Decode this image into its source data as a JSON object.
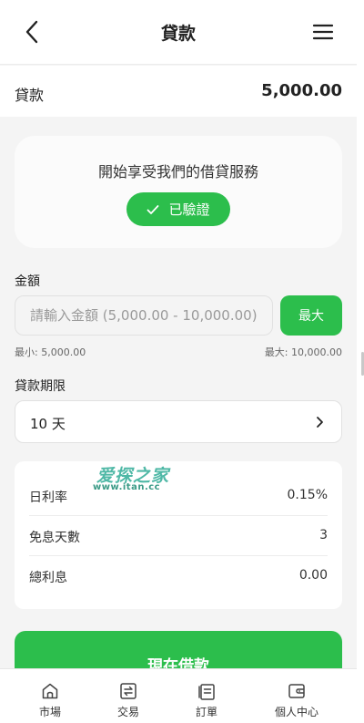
{
  "header": {
    "title": "貸款",
    "back_icon": "chevron-left-icon",
    "menu_icon": "hamburger-menu-icon"
  },
  "summary": {
    "label": "貸款",
    "value": "5,000.00"
  },
  "verify": {
    "text": "開始享受我們的借貸服務",
    "badge_label": "已驗證",
    "badge_icon": "check-icon"
  },
  "amount": {
    "label": "金額",
    "placeholder": "請輸入金額 (5,000.00 - 10,000.00)",
    "value": "",
    "max_button": "最大",
    "min_text": "最小: 5,000.00",
    "max_text": "最大: 10,000.00"
  },
  "period": {
    "label": "貸款期限",
    "value": "10 天",
    "chevron_icon": "chevron-right-icon"
  },
  "info": {
    "rows": [
      {
        "label": "日利率",
        "value": "0.15%"
      },
      {
        "label": "免息天數",
        "value": "3"
      },
      {
        "label": "總利息",
        "value": "0.00"
      }
    ]
  },
  "watermark": {
    "main": "爱探之家",
    "sub": "www.itan.cc"
  },
  "cta": {
    "label": "現在借款"
  },
  "tabbar": {
    "items": [
      {
        "label": "市場",
        "icon": "home-icon"
      },
      {
        "label": "交易",
        "icon": "exchange-icon"
      },
      {
        "label": "訂單",
        "icon": "orders-icon"
      },
      {
        "label": "個人中心",
        "icon": "wallet-icon"
      }
    ]
  },
  "colors": {
    "accent": "#2cbe4c",
    "background": "#f4f4f4",
    "card": "#ffffff",
    "text": "#222222",
    "muted": "#666666"
  }
}
